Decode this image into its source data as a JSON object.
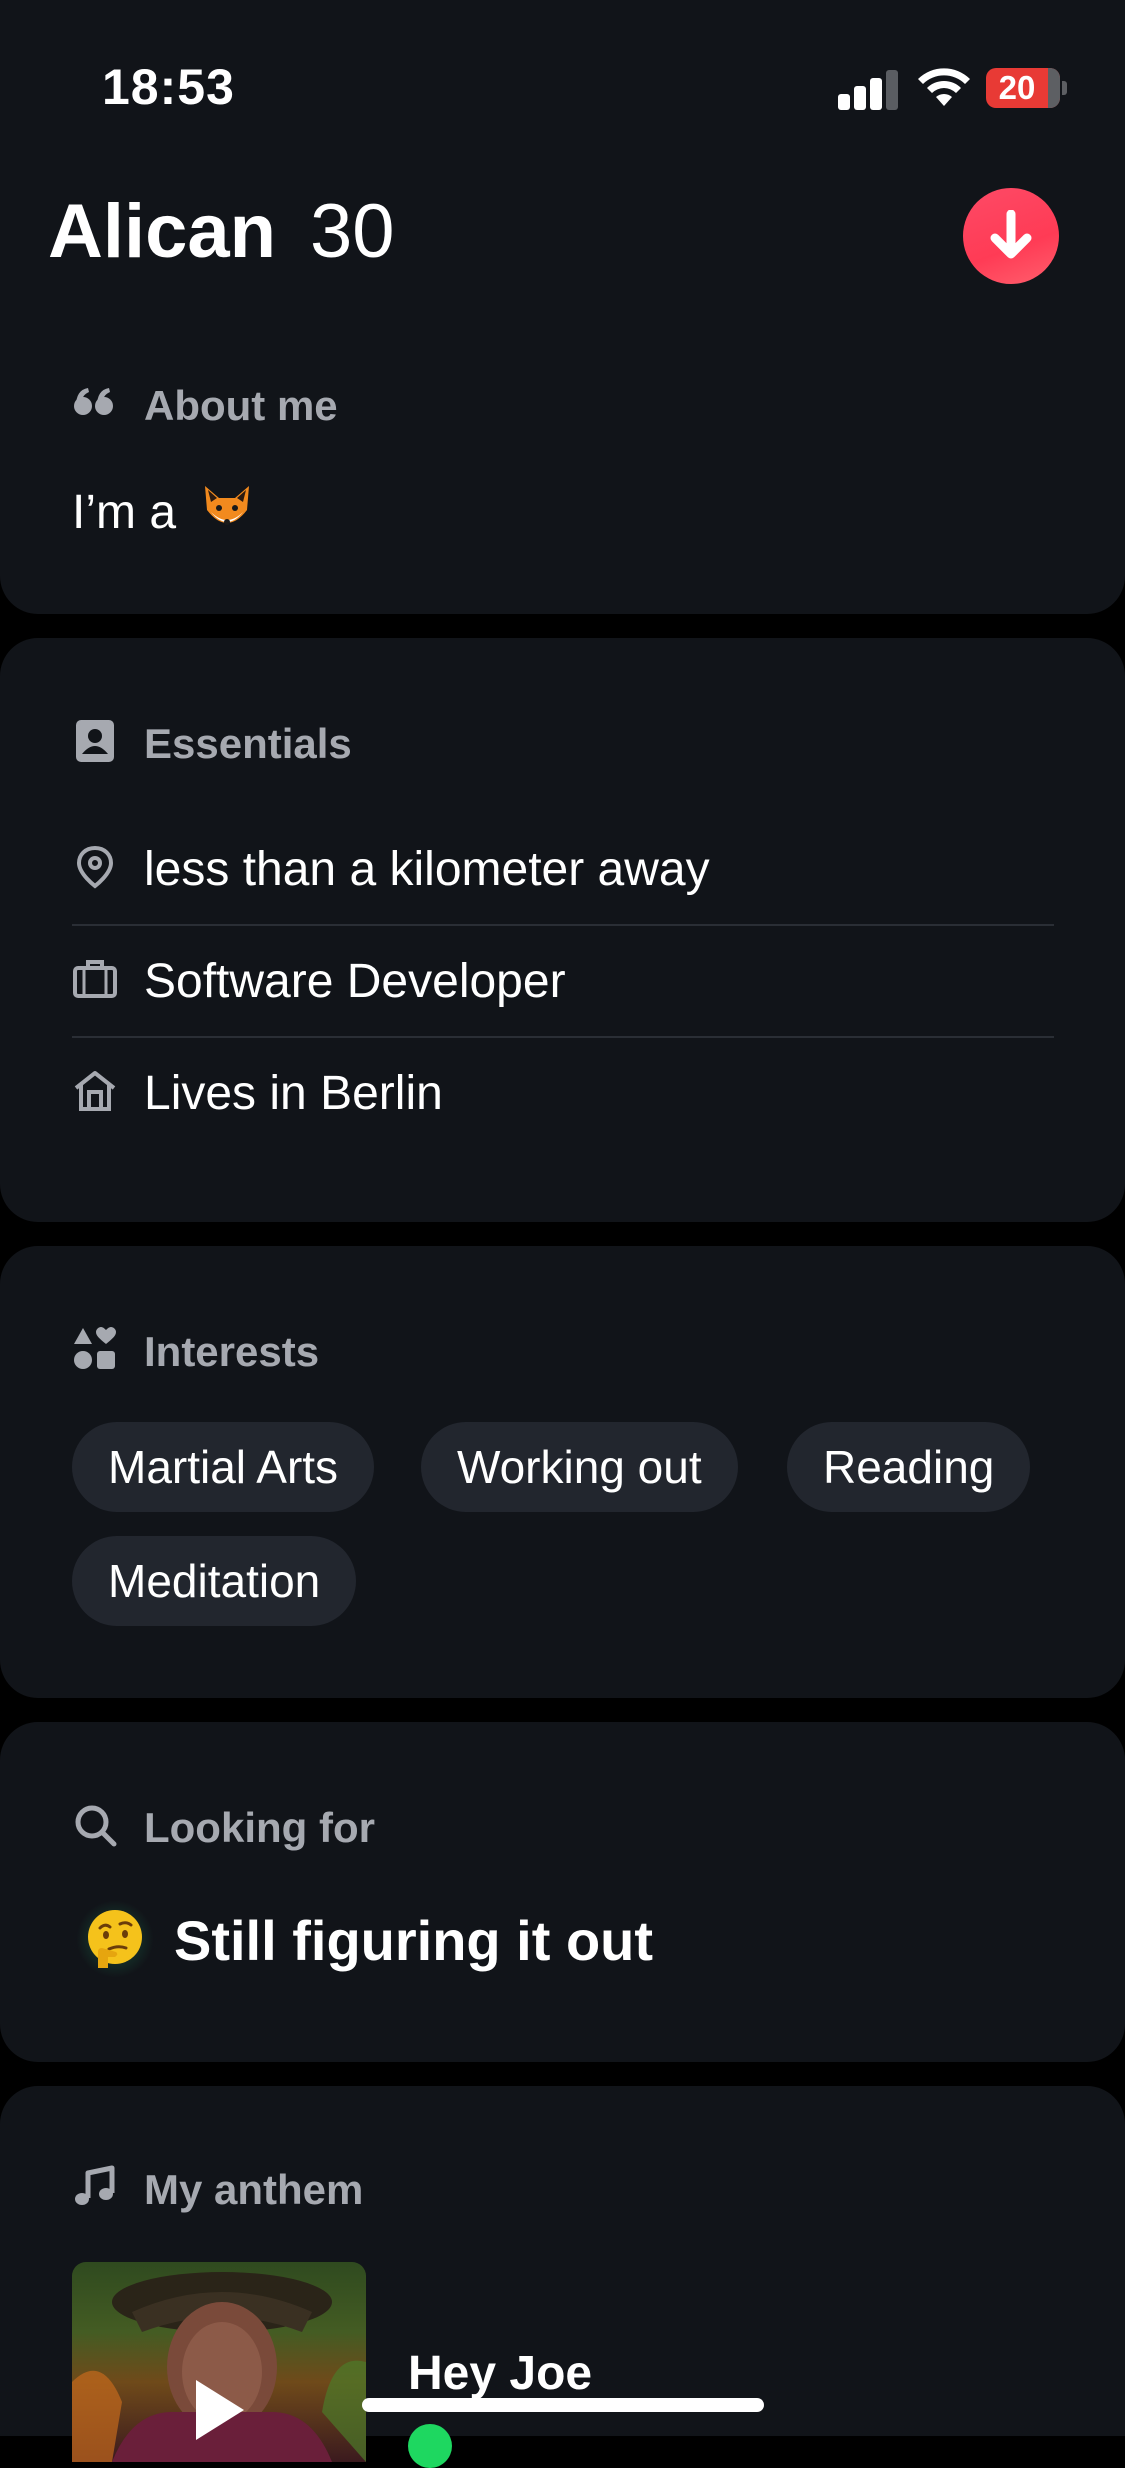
{
  "status_bar": {
    "time": "18:53",
    "battery_level": "20",
    "icons": [
      "signal-icon",
      "wifi-icon",
      "battery-icon"
    ]
  },
  "header": {
    "name": "Alican",
    "age": "30",
    "collapse_icon": "arrow-down-icon",
    "accent_color": "#fd4a66"
  },
  "about": {
    "title": "About me",
    "text": "I’m a",
    "icon": "quote-icon",
    "emoji": "fox-emoji"
  },
  "essentials": {
    "title": "Essentials",
    "icon": "profile-card-icon",
    "items": [
      {
        "icon": "location-pin-icon",
        "label": "less than a kilometer away"
      },
      {
        "icon": "briefcase-icon",
        "label": "Software Developer"
      },
      {
        "icon": "home-icon",
        "label": "Lives in Berlin"
      }
    ]
  },
  "interests": {
    "title": "Interests",
    "icon": "shapes-icon",
    "items": [
      "Martial Arts",
      "Working out",
      "Reading",
      "Meditation"
    ]
  },
  "looking_for": {
    "title": "Looking for",
    "icon": "search-icon",
    "emoji": "thinking-face-emoji",
    "value": "Still figuring it out"
  },
  "anthem": {
    "title": "My anthem",
    "icon": "music-note-icon",
    "song": "Hey Joe",
    "play_icon": "play-icon",
    "service_icon": "spotify-icon"
  },
  "colors": {
    "background": "#000000",
    "card": "#111419",
    "chip": "#22262e",
    "muted_text": "#a6a9b0",
    "spotify_green": "#1ed760"
  }
}
